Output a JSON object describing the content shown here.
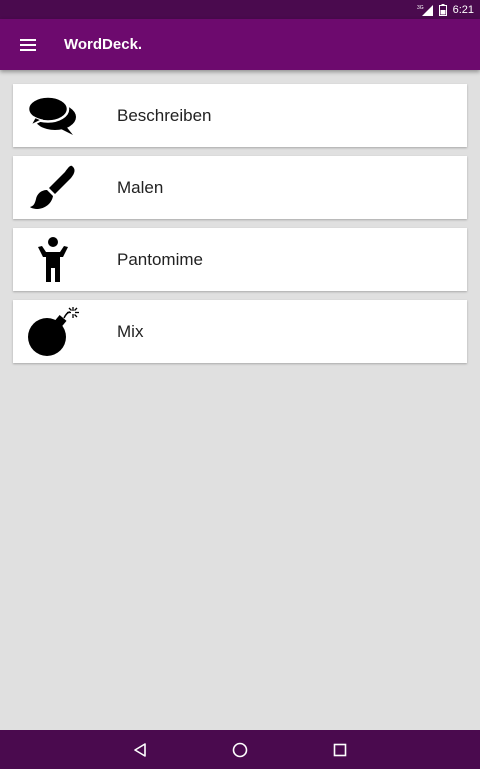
{
  "status_bar": {
    "network_label": "3G",
    "time": "6:21"
  },
  "app_bar": {
    "title": "WordDeck.",
    "menu_icon": "menu-icon"
  },
  "modes": [
    {
      "label": "Beschreiben",
      "icon": "speech-bubbles-icon"
    },
    {
      "label": "Malen",
      "icon": "paintbrush-icon"
    },
    {
      "label": "Pantomime",
      "icon": "person-icon"
    },
    {
      "label": "Mix",
      "icon": "bomb-icon"
    }
  ],
  "nav_bar": {
    "buttons": [
      "back-icon",
      "home-icon",
      "recents-icon"
    ]
  },
  "colors": {
    "status_bar": "#4a0a4e",
    "app_bar": "#6d0a6e",
    "background": "#e0e0e0",
    "card": "#ffffff"
  }
}
